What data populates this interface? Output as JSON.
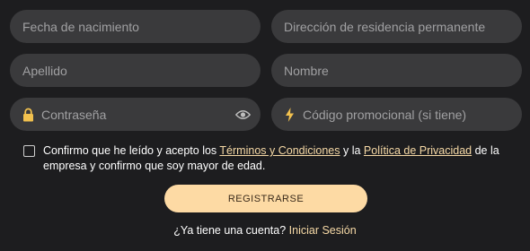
{
  "form": {
    "birth_date": {
      "placeholder": "Fecha de nacimiento",
      "icon": "none"
    },
    "permanent_address": {
      "placeholder": "Dirección de residencia permanente"
    },
    "last_name": {
      "placeholder": "Apellido"
    },
    "first_name": {
      "placeholder": "Nombre"
    },
    "password": {
      "placeholder": "Contraseña",
      "lead_icon": "lock-icon",
      "trail_icon": "eye-icon"
    },
    "promo_code": {
      "placeholder": "Código promocional (si tiene)",
      "lead_icon": "lightning-icon"
    }
  },
  "consent": {
    "text_before": "Confirmo que he leído y acepto los ",
    "terms_link": "Términos y Condiciones",
    "text_middle": " y la ",
    "privacy_link": "Política de Privacidad",
    "text_after": " de la empresa y confirmo que soy mayor de edad.",
    "checked": false
  },
  "register_button": {
    "label": "REGISTRARSE"
  },
  "login": {
    "prompt": "¿Ya tiene una cuenta? ",
    "link": "Iniciar Sesión"
  },
  "colors": {
    "background": "#1d1d1f",
    "field": "#3a3a3c",
    "accent": "#fddaa4",
    "link": "#f6d9a6",
    "icon_lock": "#f2c14e"
  }
}
